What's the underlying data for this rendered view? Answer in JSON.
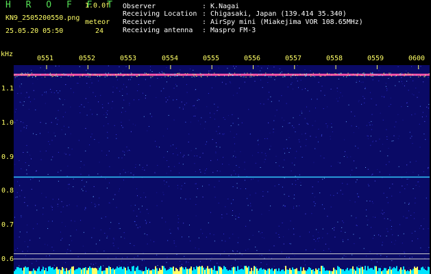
{
  "header": {
    "brand": "H R O F F T",
    "version": "1.0.0f",
    "filename": "KN9_2505200550.png",
    "mode": "meteor",
    "datetime": "25.05.20 05:50",
    "count": "24"
  },
  "info": [
    {
      "label": "Observer",
      "value": ": K.Nagai"
    },
    {
      "label": "Receiving Location",
      "value": ": Chigasaki, Japan (139.414 35.340)"
    },
    {
      "label": "Receiver",
      "value": ": AirSpy mini (Miakejima VOR 108.65MHz)"
    },
    {
      "label": "Receiving antenna",
      "value": ": Maspro FM-3"
    }
  ],
  "chart_data": {
    "type": "heatmap",
    "ylabel": "kHz",
    "x_ticks": [
      "0551",
      "0552",
      "0553",
      "0554",
      "0555",
      "0556",
      "0557",
      "0558",
      "0559",
      "0600"
    ],
    "y_ticks": [
      "1.1",
      "1.0",
      "0.9",
      "0.8",
      "0.7",
      "0.6"
    ],
    "ylim": [
      0.58,
      1.16
    ],
    "carrier_lines_khz": [
      1.14,
      0.84,
      0.615,
      0.6
    ],
    "colors": {
      "background": "#0a0a66",
      "carrier": "#ff55aa",
      "line": "#33ccff",
      "accent": "#ffff66"
    }
  }
}
